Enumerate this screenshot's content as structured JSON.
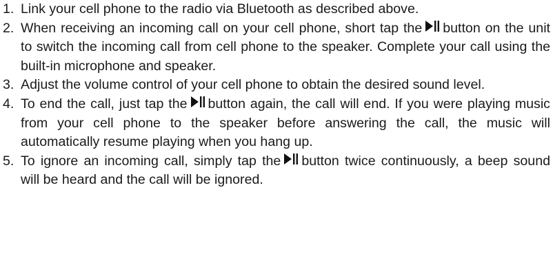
{
  "instructions": [
    {
      "number": "1.",
      "text": "Link your cell phone to the radio via Bluetooth as described above."
    },
    {
      "number": "2.",
      "before": "When receiving an incoming call on your cell phone, short tap the",
      "icon": "play-pause-icon",
      "after": "button on the unit to switch the incoming call from cell phone to the speaker. Complete your call using the built-in microphone and speaker."
    },
    {
      "number": "3.",
      "text": "Adjust the volume control of your cell phone to obtain the desired sound level."
    },
    {
      "number": "4.",
      "before": "To end the call, just tap the",
      "icon": "play-pause-icon",
      "after": "button again, the call will end. If you were playing music from your cell phone to the speaker before answering the call, the music will automatically resume playing when you hang up."
    },
    {
      "number": "5.",
      "before": "To ignore an incoming call, simply tap the",
      "icon": "play-pause-icon",
      "after": "button twice continuously, a beep sound will be heard and the call will be ignored."
    }
  ]
}
